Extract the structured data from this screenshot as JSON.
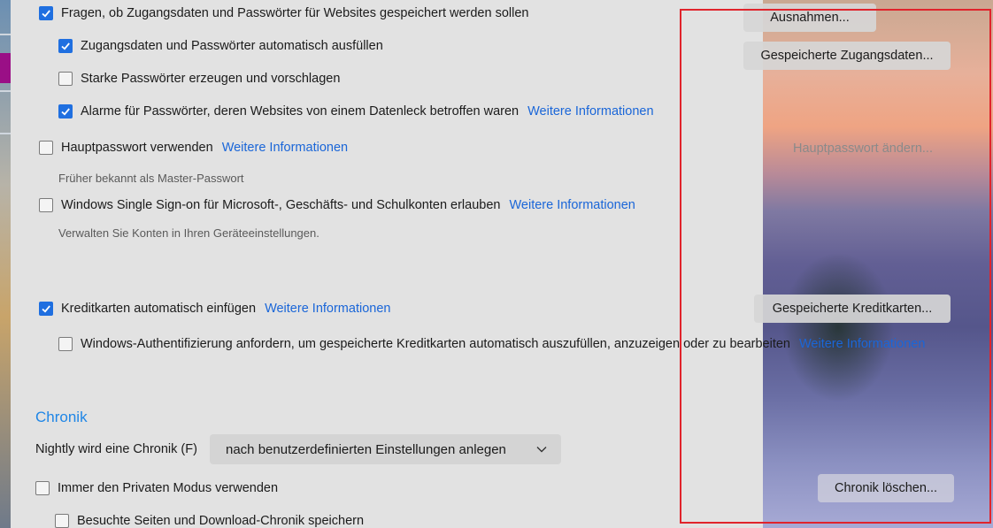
{
  "logins": {
    "ask_save": {
      "label": "Fragen, ob Zugangsdaten und Passwörter für Websites gespeichert werden sollen",
      "checked": true
    },
    "autofill": {
      "label": "Zugangsdaten und Passwörter automatisch ausfüllen",
      "checked": true
    },
    "strong_pw": {
      "label": "Starke Passwörter erzeugen und vorschlagen",
      "checked": false
    },
    "breach_alerts": {
      "label": "Alarme für Passwörter, deren Websites von einem Datenleck betroffen waren",
      "checked": true,
      "link": "Weitere Informationen"
    },
    "exceptions_button": "Ausnahmen...",
    "saved_logins_button": "Gespeicherte Zugangsdaten..."
  },
  "primary_password": {
    "label": "Hauptpasswort verwenden",
    "checked": false,
    "link": "Weitere Informationen",
    "note": "Früher bekannt als Master-Passwort",
    "change_button": "Hauptpasswort ändern..."
  },
  "sso": {
    "label": "Windows Single Sign-on für Microsoft-, Geschäfts- und Schulkonten erlauben",
    "checked": false,
    "link": "Weitere Informationen",
    "note": "Verwalten Sie Konten in Ihren Geräteeinstellungen."
  },
  "credit_cards": {
    "label": "Kreditkarten automatisch einfügen",
    "checked": true,
    "link": "Weitere Informationen",
    "saved_button": "Gespeicherte Kreditkarten...",
    "windows_auth": {
      "label": "Windows-Authentifizierung anfordern, um gespeicherte Kreditkarten automatisch auszufüllen, anzuzeigen oder zu bearbeiten",
      "checked": false,
      "link": "Weitere Informationen"
    }
  },
  "history": {
    "title": "Chronik",
    "mode_label": "Nightly wird eine Chronik (F)",
    "mode_value": "nach benutzerdefinierten Einstellungen anlegen",
    "private_mode": {
      "label": "Immer den Privaten Modus verwenden",
      "checked": false
    },
    "save_history": {
      "label": "Besuchte Seiten und Download-Chronik speichern",
      "checked": false
    },
    "clear_button": "Chronik löschen..."
  },
  "colors": {
    "accent": "#1f6fe0",
    "link": "#1a66d8",
    "section_title": "#1f86e6",
    "highlight_frame": "#e0242c"
  }
}
